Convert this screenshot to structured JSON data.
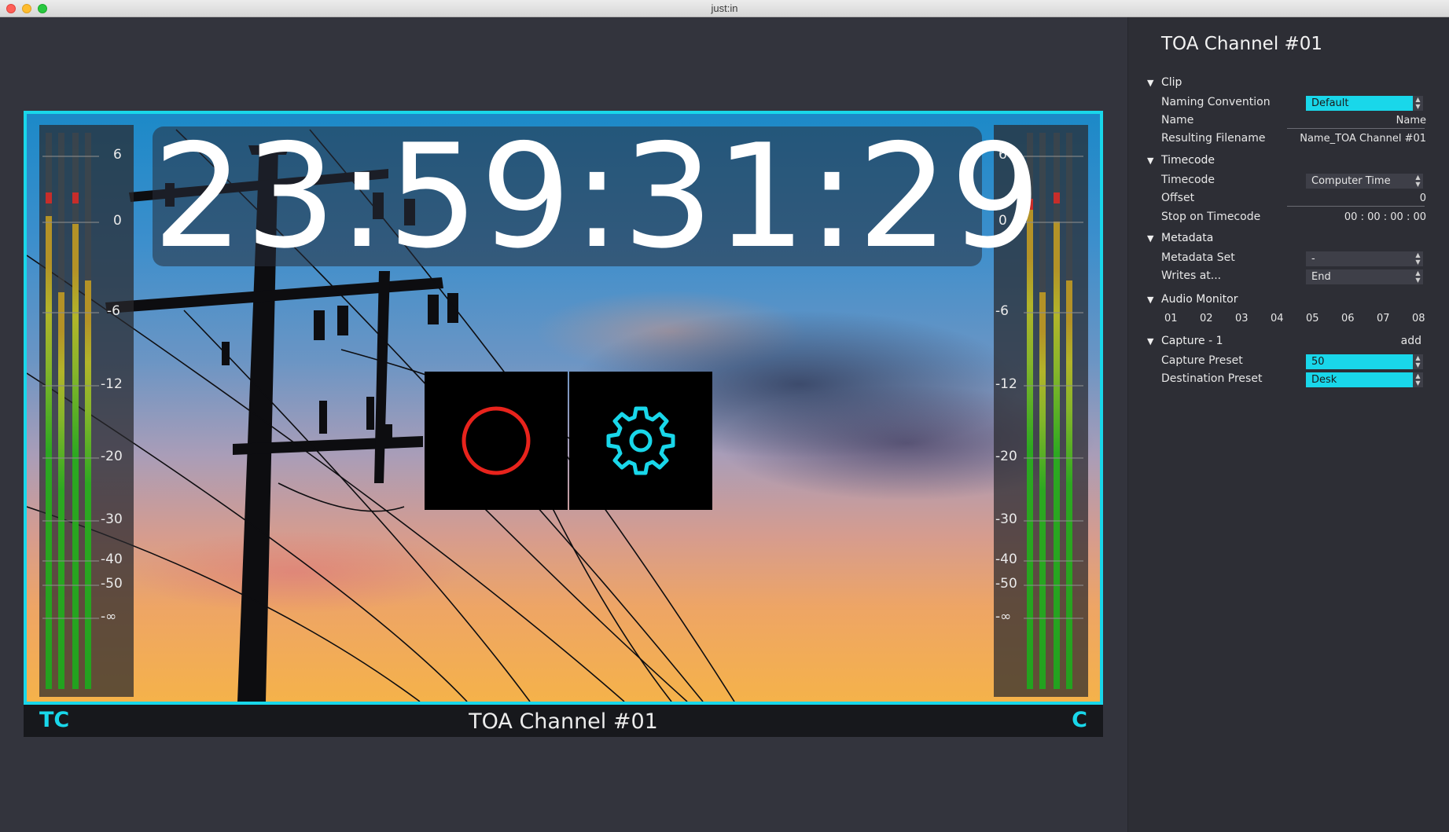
{
  "window": {
    "title": "just:in"
  },
  "video": {
    "timecode": "23:59:31:29",
    "meter_scale": [
      "6",
      "0",
      "-6",
      "-12",
      "-20",
      "-30",
      "-40",
      "-50",
      "-∞"
    ],
    "record_icon": "record-circle-icon",
    "settings_icon": "gear-icon",
    "bottom": {
      "left_label": "TC",
      "channel_name": "TOA Channel #01",
      "right_label": "C"
    }
  },
  "panel": {
    "title": "TOA Channel #01",
    "clip": {
      "header": "Clip",
      "naming_convention_label": "Naming Convention",
      "naming_convention_value": "Default",
      "name_label": "Name",
      "name_value": "Name",
      "resulting_filename_label": "Resulting Filename",
      "resulting_filename_value": "Name_TOA Channel #01"
    },
    "timecode": {
      "header": "Timecode",
      "timecode_label": "Timecode",
      "timecode_value": "Computer Time",
      "offset_label": "Offset",
      "offset_value": "0",
      "stop_label": "Stop on Timecode",
      "stop_value": "00 : 00 : 00 : 00"
    },
    "metadata": {
      "header": "Metadata",
      "set_label": "Metadata Set",
      "set_value": "-",
      "writes_label": "Writes at...",
      "writes_value": "End"
    },
    "audio_monitor": {
      "header": "Audio Monitor",
      "channels": [
        "01",
        "02",
        "03",
        "04",
        "05",
        "06",
        "07",
        "08"
      ]
    },
    "capture": {
      "header": "Capture - 1",
      "add_label": "add",
      "preset_label": "Capture Preset",
      "preset_value": "50",
      "destination_label": "Destination Preset",
      "destination_value": "Desk"
    }
  },
  "colors": {
    "accent": "#19d7ea",
    "record": "#e8231c",
    "background": "#33343d",
    "panel": "#2d2e35"
  }
}
